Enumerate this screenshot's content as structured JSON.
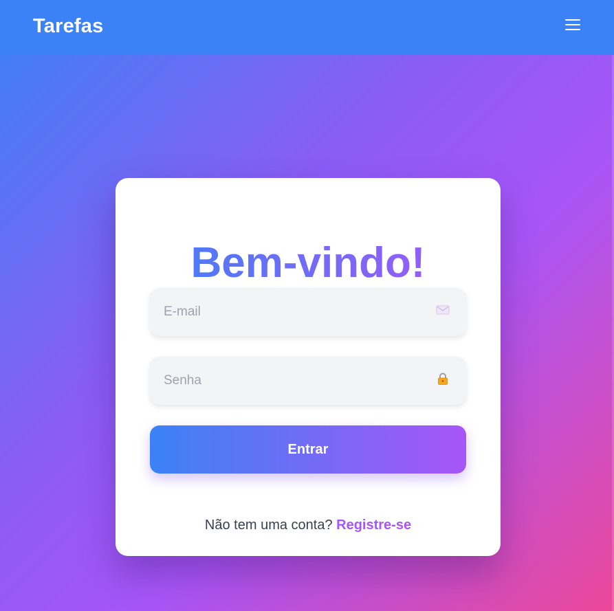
{
  "app": {
    "brand": "Tarefas"
  },
  "navbar": {
    "menu_icon": "hamburger-menu-icon",
    "background_color": "#3b82f6"
  },
  "login": {
    "title": "Bem-vindo!",
    "email": {
      "placeholder": "E-mail",
      "value": "",
      "icon": "envelope-icon"
    },
    "password": {
      "placeholder": "Senha",
      "value": "",
      "icon": "lock-icon"
    },
    "submit_label": "Entrar",
    "register_prompt": "Não tem uma conta?",
    "register_link": "Registre-se"
  },
  "colors": {
    "accent_blue": "#3b82f6",
    "accent_purple": "#a855f7",
    "accent_pink": "#ec4899",
    "input_bg": "#f3f4f6",
    "text_muted": "#9ca3af"
  }
}
